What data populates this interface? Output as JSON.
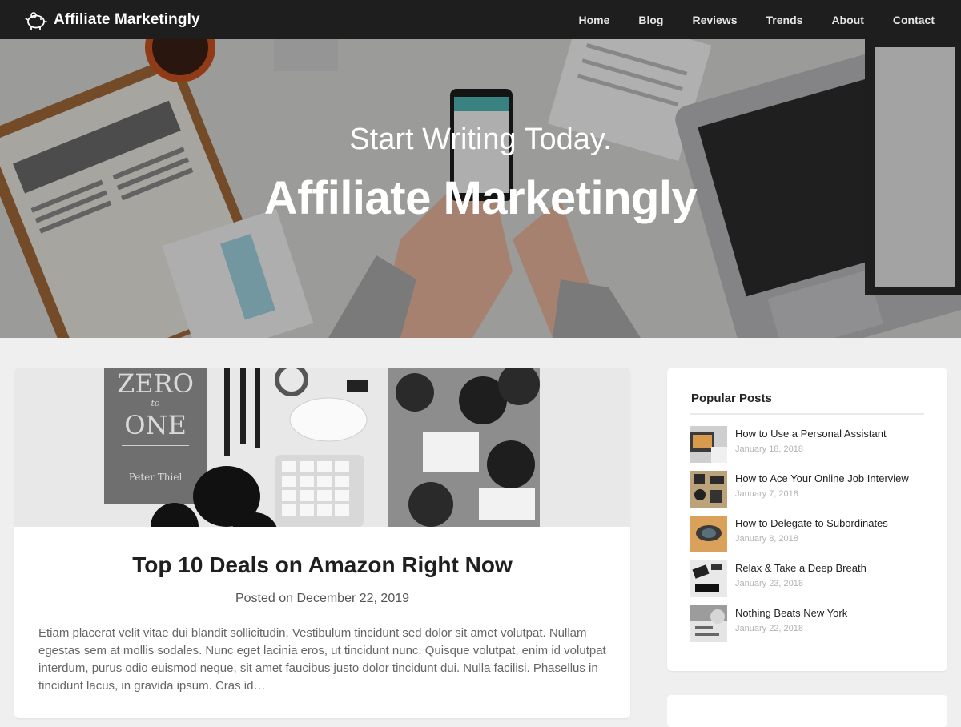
{
  "site": {
    "name": "Affiliate Marketingly"
  },
  "nav": {
    "items": [
      "Home",
      "Blog",
      "Reviews",
      "Trends",
      "About",
      "Contact"
    ]
  },
  "hero": {
    "subtitle": "Start Writing Today.",
    "title": "Affiliate Marketingly"
  },
  "post": {
    "title": "Top 10 Deals on Amazon Right Now",
    "date": "Posted on December 22, 2019",
    "excerpt": "Etiam placerat velit vitae dui blandit sollicitudin. Vestibulum tincidunt sed dolor sit amet volutpat. Nullam egestas sem at mollis sodales. Nunc eget lacinia eros, ut tincidunt nunc. Quisque volutpat, enim id volutpat interdum, purus odio euismod neque, sit amet faucibus justo dolor tincidunt dui. Nulla facilisi. Phasellus in tincidunt lacus, in gravida ipsum. Cras id…",
    "image_text": {
      "book_line1": "ZERO",
      "book_line2": "to",
      "book_line3": "ONE",
      "book_author": "Peter Thiel"
    }
  },
  "sidebar": {
    "popular_title": "Popular Posts",
    "popular": [
      {
        "title": "How to Use a Personal Assistant",
        "date": "January 18, 2018"
      },
      {
        "title": "How to Ace Your Online Job Interview",
        "date": "January 7, 2018"
      },
      {
        "title": "How to Delegate to Subordinates",
        "date": "January 8, 2018"
      },
      {
        "title": "Relax & Take a Deep Breath",
        "date": "January 23, 2018"
      },
      {
        "title": "Nothing Beats New York",
        "date": "January 22, 2018"
      }
    ]
  },
  "colors": {
    "navbar": "#1e1e1e",
    "page_bg": "#efefef",
    "card_bg": "#ffffff",
    "muted_text": "#b3b3b3"
  },
  "icons": {
    "brand_logo": "piggy-bank-icon"
  }
}
